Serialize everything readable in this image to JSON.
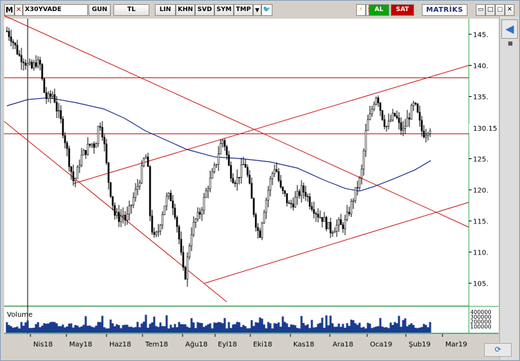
{
  "toolbar": {
    "m_label": "M",
    "close_label": "✕",
    "symbol": "X30YVADE",
    "period": "GUN",
    "currency": "TL",
    "btn_lin": "LIN",
    "btn_khn": "KHN",
    "btn_svd": "SVD",
    "btn_sym": "SYM",
    "btn_tmp": "TMP",
    "dropdown_icon": "▼",
    "twitter_icon": "🐦",
    "bolt_icon": "⚡",
    "s_label": "S",
    "buy_label": "AL",
    "sell_label": "SAT",
    "brand": "MATRİKS",
    "win_min": "▭",
    "win_restore": "□",
    "win_max": "▢",
    "win_close": "✕"
  },
  "side": {
    "back_icon": "◀",
    "refresh_icon": "⟳"
  },
  "chart_data": {
    "type": "candlestick",
    "symbol": "X30YVADE",
    "y_ticks": [
      145,
      140,
      135,
      130,
      125,
      120,
      115,
      110,
      105
    ],
    "y_tick_labels": [
      "145.",
      "140.",
      "135.",
      "130.",
      "125.",
      "120.",
      "115.",
      "110.",
      "105."
    ],
    "ylim": [
      101.5,
      147.5
    ],
    "last_price_label": "130.15",
    "last_price": 130.15,
    "x_tick_labels": [
      "Nis18",
      "May18",
      "Haz18",
      "Tem18",
      "Ağu18",
      "Eyl18",
      "Eki18",
      "Kas18",
      "Ara18",
      "Oca19",
      "Şub19",
      "Mar19"
    ],
    "price_path": [
      [
        0,
        145.5
      ],
      [
        6,
        144.5
      ],
      [
        12,
        143
      ],
      [
        18,
        141.5
      ],
      [
        24,
        141
      ],
      [
        30,
        140
      ],
      [
        36,
        139.5
      ],
      [
        42,
        140.5
      ],
      [
        48,
        140
      ],
      [
        53,
        136
      ],
      [
        58,
        134.5
      ],
      [
        63,
        135
      ],
      [
        67,
        135.5
      ],
      [
        72,
        133
      ],
      [
        78,
        131
      ],
      [
        84,
        128
      ],
      [
        90,
        124.5
      ],
      [
        96,
        121.5
      ],
      [
        100,
        122
      ],
      [
        106,
        125
      ],
      [
        112,
        126
      ],
      [
        118,
        127
      ],
      [
        124,
        127.5
      ],
      [
        128,
        127
      ],
      [
        130,
        129
      ],
      [
        134,
        131
      ],
      [
        137,
        130
      ],
      [
        141,
        127
      ],
      [
        146,
        122
      ],
      [
        151,
        119
      ],
      [
        156,
        116
      ],
      [
        162,
        115.5
      ],
      [
        168,
        116
      ],
      [
        172,
        115
      ],
      [
        178,
        117
      ],
      [
        184,
        119
      ],
      [
        190,
        121
      ],
      [
        196,
        123.5
      ],
      [
        200,
        126
      ],
      [
        204,
        123
      ],
      [
        207,
        116
      ],
      [
        212,
        112
      ],
      [
        218,
        113
      ],
      [
        224,
        116
      ],
      [
        230,
        118.5
      ],
      [
        236,
        119
      ],
      [
        242,
        117
      ],
      [
        248,
        113
      ],
      [
        254,
        107.5
      ],
      [
        257,
        105.5
      ],
      [
        260,
        108
      ],
      [
        266,
        113
      ],
      [
        272,
        115
      ],
      [
        278,
        116
      ],
      [
        284,
        118
      ],
      [
        290,
        120.5
      ],
      [
        296,
        122
      ],
      [
        302,
        124
      ],
      [
        308,
        127
      ],
      [
        312,
        128
      ],
      [
        316,
        127
      ],
      [
        320,
        124
      ],
      [
        326,
        122
      ],
      [
        332,
        121.5
      ],
      [
        338,
        123
      ],
      [
        344,
        124.5
      ],
      [
        350,
        121
      ],
      [
        356,
        117
      ],
      [
        362,
        113.5
      ],
      [
        366,
        113
      ],
      [
        370,
        116
      ],
      [
        376,
        119
      ],
      [
        382,
        122
      ],
      [
        388,
        124
      ],
      [
        392,
        122
      ],
      [
        396,
        120
      ],
      [
        402,
        119
      ],
      [
        408,
        117.5
      ],
      [
        414,
        118
      ],
      [
        420,
        119
      ],
      [
        426,
        120
      ],
      [
        432,
        119.5
      ],
      [
        438,
        118
      ],
      [
        444,
        117
      ],
      [
        450,
        116
      ],
      [
        456,
        115.5
      ],
      [
        462,
        114.5
      ],
      [
        468,
        113.5
      ],
      [
        474,
        114
      ],
      [
        480,
        114.5
      ],
      [
        484,
        114
      ],
      [
        490,
        115
      ],
      [
        496,
        117
      ],
      [
        502,
        119
      ],
      [
        508,
        121
      ],
      [
        512,
        122
      ],
      [
        515,
        125
      ],
      [
        518,
        128.5
      ],
      [
        522,
        131
      ],
      [
        526,
        132
      ],
      [
        530,
        134
      ],
      [
        535,
        135.5
      ],
      [
        540,
        133
      ],
      [
        545,
        131
      ],
      [
        550,
        130
      ],
      [
        556,
        131.5
      ],
      [
        562,
        132
      ],
      [
        568,
        130
      ],
      [
        573,
        129.5
      ],
      [
        578,
        131
      ],
      [
        584,
        132.5
      ],
      [
        588,
        133.5
      ],
      [
        592,
        133
      ],
      [
        596,
        131
      ],
      [
        600,
        129.5
      ],
      [
        604,
        129
      ],
      [
        607,
        129.5
      ],
      [
        610,
        130
      ],
      [
        613,
        130.15
      ]
    ],
    "moving_average_path": [
      [
        0,
        133.5
      ],
      [
        30,
        134.5
      ],
      [
        60,
        134.8
      ],
      [
        100,
        134
      ],
      [
        140,
        133
      ],
      [
        170,
        131.5
      ],
      [
        200,
        129.5
      ],
      [
        230,
        128
      ],
      [
        260,
        126.5
      ],
      [
        300,
        125.3
      ],
      [
        340,
        125
      ],
      [
        380,
        124.5
      ],
      [
        420,
        123.5
      ],
      [
        460,
        121.5
      ],
      [
        490,
        120.2
      ],
      [
        510,
        119.8
      ],
      [
        530,
        120.5
      ],
      [
        560,
        121.8
      ],
      [
        590,
        123.2
      ],
      [
        613,
        124.7
      ]
    ],
    "trendlines": [
      {
        "type": "downtrend_upper",
        "from": [
          0,
          148
        ],
        "to": [
          672,
          114
        ]
      },
      {
        "type": "downtrend_lower",
        "from": [
          0,
          131
        ],
        "to": [
          322,
          102
        ]
      },
      {
        "type": "uptrend_lower",
        "from": [
          290,
          105
        ],
        "to": [
          672,
          118
        ]
      },
      {
        "type": "uptrend_upper",
        "from": [
          100,
          121
        ],
        "to": [
          672,
          140
        ]
      },
      {
        "type": "resistance",
        "from": [
          0,
          138
        ],
        "to": [
          672,
          138
        ]
      },
      {
        "type": "support",
        "from": [
          0,
          129
        ],
        "to": [
          672,
          129
        ]
      }
    ],
    "volume_label": "Volume",
    "volume_tick_labels": [
      "400000",
      "300000",
      "200000",
      "100000"
    ],
    "colors": {
      "candle": "#000000",
      "moving_average": "#1c2e8e",
      "trendline": "#cc1111",
      "volume": "#1a3c90",
      "plot_background": "#ffffff",
      "frame_accent": "#2fa84f"
    }
  }
}
